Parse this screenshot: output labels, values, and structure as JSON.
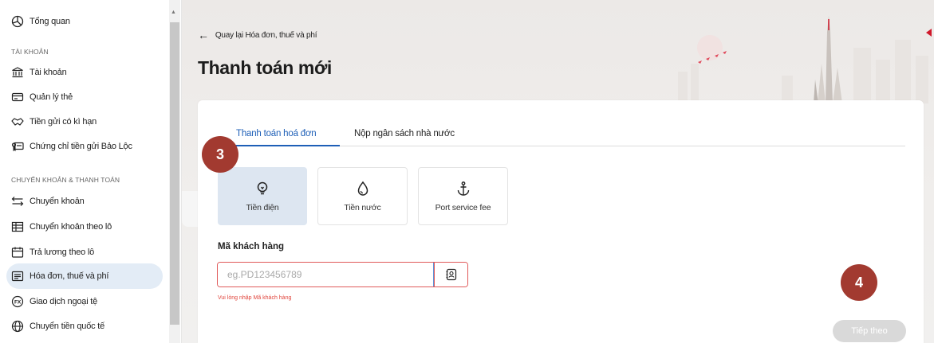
{
  "sidebar": {
    "items": [
      {
        "label": "Tổng quan",
        "icon": "chart-pie-icon"
      },
      {
        "label": "Tài khoản",
        "icon": "bank-icon"
      },
      {
        "label": "Quản lý thẻ",
        "icon": "card-icon"
      },
      {
        "label": "Tiền gửi có kì hạn",
        "icon": "handshake-icon"
      },
      {
        "label": "Chứng chỉ tiền gửi Bảo Lộc",
        "icon": "certificate-icon"
      },
      {
        "label": "Chuyển khoản",
        "icon": "transfer-icon"
      },
      {
        "label": "Chuyển khoản theo lô",
        "icon": "table-icon"
      },
      {
        "label": "Trả lương theo lô",
        "icon": "calendar-icon"
      },
      {
        "label": "Hóa đơn, thuế và phí",
        "icon": "invoice-icon"
      },
      {
        "label": "Giao dịch ngoại tệ",
        "icon": "fx-icon"
      },
      {
        "label": "Chuyển tiền quốc tế",
        "icon": "globe-icon"
      }
    ],
    "sections": {
      "account": "TÀI KHOẢN",
      "transfer": "CHUYỂN KHOẢN & THANH TOÁN"
    },
    "active_item": "Hóa đơn, thuế và phí"
  },
  "header": {
    "back_label": "Quay lại Hóa đơn, thuế và phí",
    "title": "Thanh toán mới"
  },
  "tabs": [
    {
      "label": "Thanh toán hoá đơn",
      "active": true
    },
    {
      "label": "Nộp ngân sách nhà nước",
      "active": false
    }
  ],
  "services": [
    {
      "label": "Tiền điện",
      "icon": "lightbulb-icon",
      "selected": true
    },
    {
      "label": "Tiền nước",
      "icon": "water-drop-icon",
      "selected": false
    },
    {
      "label": "Port service fee",
      "icon": "anchor-icon",
      "selected": false
    }
  ],
  "form": {
    "customer_label": "Mã khách hàng",
    "customer_placeholder": "eg.PD123456789",
    "customer_value": "",
    "error": "Vui lòng nhập Mã khách hàng"
  },
  "actions": {
    "next_label": "Tiếp theo"
  },
  "annotations": {
    "step_3": "3",
    "step_4": "4"
  },
  "colors": {
    "accent": "#1e5fb7",
    "error": "#e0443b",
    "badge": "#a23a30",
    "brand_red": "#d0182b"
  }
}
